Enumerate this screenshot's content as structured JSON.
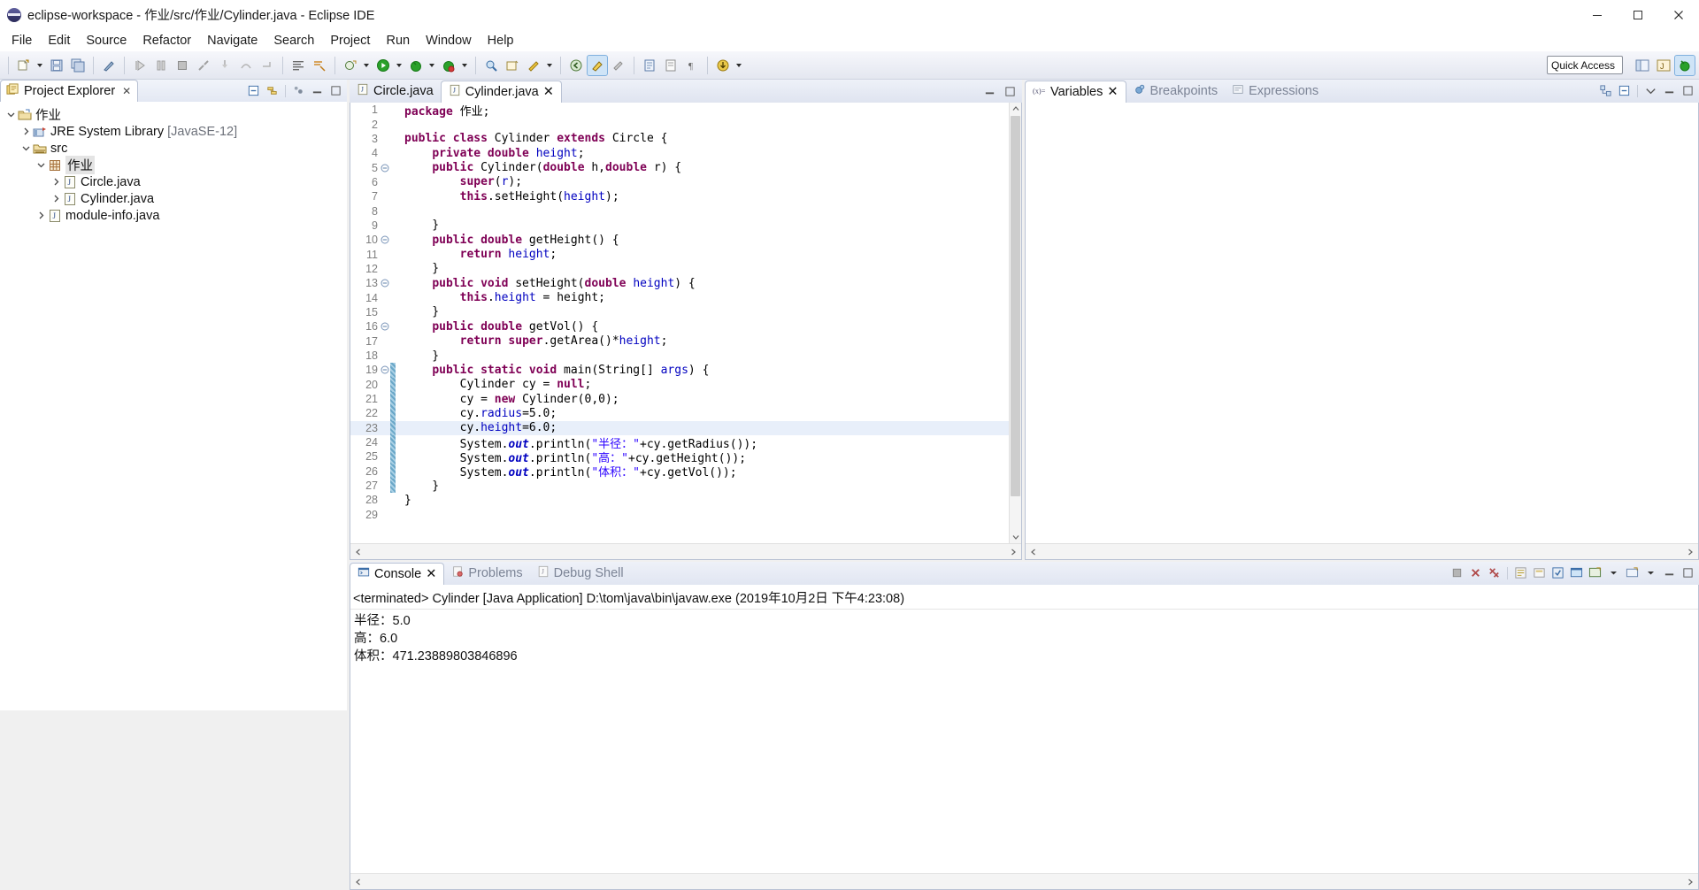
{
  "window": {
    "title": "eclipse-workspace - 作业/src/作业/Cylinder.java - Eclipse IDE",
    "minimize": "minimize-button",
    "maximize": "maximize-button",
    "close": "close-button"
  },
  "menubar": {
    "items": [
      "File",
      "Edit",
      "Source",
      "Refactor",
      "Navigate",
      "Search",
      "Project",
      "Run",
      "Window",
      "Help"
    ]
  },
  "toolbar": {
    "quick_access_placeholder": "Quick Access"
  },
  "explorer": {
    "tab_label": "Project Explorer",
    "tree": [
      {
        "label": "作业",
        "indent": 0,
        "twist": "down",
        "icon": "project-icon"
      },
      {
        "label": "JRE System Library",
        "suffix": " [JavaSE-12]",
        "indent": 1,
        "twist": "right",
        "icon": "library-icon"
      },
      {
        "label": "src",
        "indent": 1,
        "twist": "down",
        "icon": "source-folder-icon"
      },
      {
        "label": "作业",
        "indent": 2,
        "twist": "down",
        "icon": "package-icon",
        "highlight": true
      },
      {
        "label": "Circle.java",
        "indent": 3,
        "twist": "right",
        "icon": "java-file-icon"
      },
      {
        "label": "Cylinder.java",
        "indent": 3,
        "twist": "right",
        "icon": "java-file-icon"
      },
      {
        "label": "module-info.java",
        "indent": 2,
        "twist": "right",
        "icon": "java-file-icon"
      }
    ]
  },
  "editor": {
    "tabs": [
      {
        "label": "Circle.java",
        "active": false,
        "closable": false
      },
      {
        "label": "Cylinder.java",
        "active": true,
        "closable": true
      }
    ],
    "current_line": 23,
    "change_bar_lines": [
      19,
      20,
      21,
      22,
      23,
      24,
      25,
      26,
      27
    ],
    "lines": [
      {
        "n": 1,
        "fold": false,
        "tokens": [
          {
            "t": "package ",
            "c": "kw"
          },
          {
            "t": "作业",
            "c": ""
          },
          {
            "t": ";",
            "c": ""
          }
        ]
      },
      {
        "n": 2,
        "fold": false,
        "tokens": []
      },
      {
        "n": 3,
        "fold": false,
        "tokens": [
          {
            "t": "public class ",
            "c": "kw"
          },
          {
            "t": "Cylinder ",
            "c": ""
          },
          {
            "t": "extends ",
            "c": "kw"
          },
          {
            "t": "Circle {",
            "c": ""
          }
        ]
      },
      {
        "n": 4,
        "fold": false,
        "tokens": [
          {
            "t": "    ",
            "c": ""
          },
          {
            "t": "private double ",
            "c": "kw"
          },
          {
            "t": "height",
            "c": "fld"
          },
          {
            "t": ";",
            "c": ""
          }
        ]
      },
      {
        "n": 5,
        "fold": true,
        "tokens": [
          {
            "t": "    ",
            "c": ""
          },
          {
            "t": "public ",
            "c": "kw"
          },
          {
            "t": "Cylinder(",
            "c": ""
          },
          {
            "t": "double ",
            "c": "kw"
          },
          {
            "t": "h,",
            "c": ""
          },
          {
            "t": "double ",
            "c": "kw"
          },
          {
            "t": "r) {",
            "c": ""
          }
        ]
      },
      {
        "n": 6,
        "fold": false,
        "tokens": [
          {
            "t": "        ",
            "c": ""
          },
          {
            "t": "super",
            "c": "kw"
          },
          {
            "t": "(",
            "c": ""
          },
          {
            "t": "r",
            "c": "fld"
          },
          {
            "t": ");",
            "c": ""
          }
        ]
      },
      {
        "n": 7,
        "fold": false,
        "tokens": [
          {
            "t": "        ",
            "c": ""
          },
          {
            "t": "this",
            "c": "kw"
          },
          {
            "t": ".setHeight(",
            "c": ""
          },
          {
            "t": "height",
            "c": "fld"
          },
          {
            "t": ");",
            "c": ""
          }
        ]
      },
      {
        "n": 8,
        "fold": false,
        "tokens": []
      },
      {
        "n": 9,
        "fold": false,
        "tokens": [
          {
            "t": "    }",
            "c": ""
          }
        ]
      },
      {
        "n": 10,
        "fold": true,
        "tokens": [
          {
            "t": "    ",
            "c": ""
          },
          {
            "t": "public double ",
            "c": "kw"
          },
          {
            "t": "getHeight() {",
            "c": ""
          }
        ]
      },
      {
        "n": 11,
        "fold": false,
        "tokens": [
          {
            "t": "        ",
            "c": ""
          },
          {
            "t": "return ",
            "c": "kw"
          },
          {
            "t": "height",
            "c": "fld"
          },
          {
            "t": ";",
            "c": ""
          }
        ]
      },
      {
        "n": 12,
        "fold": false,
        "tokens": [
          {
            "t": "    }",
            "c": ""
          }
        ]
      },
      {
        "n": 13,
        "fold": true,
        "tokens": [
          {
            "t": "    ",
            "c": ""
          },
          {
            "t": "public void ",
            "c": "kw"
          },
          {
            "t": "setHeight(",
            "c": ""
          },
          {
            "t": "double ",
            "c": "kw"
          },
          {
            "t": "height",
            "c": "fld"
          },
          {
            "t": ") {",
            "c": ""
          }
        ]
      },
      {
        "n": 14,
        "fold": false,
        "tokens": [
          {
            "t": "        ",
            "c": ""
          },
          {
            "t": "this",
            "c": "kw"
          },
          {
            "t": ".",
            "c": ""
          },
          {
            "t": "height",
            "c": "fld"
          },
          {
            "t": " = height;",
            "c": ""
          }
        ]
      },
      {
        "n": 15,
        "fold": false,
        "tokens": [
          {
            "t": "    }",
            "c": ""
          }
        ]
      },
      {
        "n": 16,
        "fold": true,
        "tokens": [
          {
            "t": "    ",
            "c": ""
          },
          {
            "t": "public double ",
            "c": "kw"
          },
          {
            "t": "getVol() {",
            "c": ""
          }
        ]
      },
      {
        "n": 17,
        "fold": false,
        "tokens": [
          {
            "t": "        ",
            "c": ""
          },
          {
            "t": "return ",
            "c": "kw"
          },
          {
            "t": "super",
            "c": "kw"
          },
          {
            "t": ".getArea()*",
            "c": ""
          },
          {
            "t": "height",
            "c": "fld"
          },
          {
            "t": ";",
            "c": ""
          }
        ]
      },
      {
        "n": 18,
        "fold": false,
        "tokens": [
          {
            "t": "    }",
            "c": ""
          }
        ]
      },
      {
        "n": 19,
        "fold": true,
        "tokens": [
          {
            "t": "    ",
            "c": ""
          },
          {
            "t": "public static void ",
            "c": "kw"
          },
          {
            "t": "main(String[] ",
            "c": ""
          },
          {
            "t": "args",
            "c": "fld"
          },
          {
            "t": ") {",
            "c": ""
          }
        ]
      },
      {
        "n": 20,
        "fold": false,
        "tokens": [
          {
            "t": "        Cylinder cy = ",
            "c": ""
          },
          {
            "t": "null",
            "c": "kw"
          },
          {
            "t": ";",
            "c": ""
          }
        ]
      },
      {
        "n": 21,
        "fold": false,
        "tokens": [
          {
            "t": "        cy = ",
            "c": ""
          },
          {
            "t": "new ",
            "c": "kw"
          },
          {
            "t": "Cylinder(0,0);",
            "c": ""
          }
        ]
      },
      {
        "n": 22,
        "fold": false,
        "tokens": [
          {
            "t": "        cy.",
            "c": ""
          },
          {
            "t": "radius",
            "c": "fld"
          },
          {
            "t": "=5.0;",
            "c": ""
          }
        ]
      },
      {
        "n": 23,
        "fold": false,
        "tokens": [
          {
            "t": "        cy.",
            "c": ""
          },
          {
            "t": "height",
            "c": "fld"
          },
          {
            "t": "=6.0;",
            "c": ""
          }
        ]
      },
      {
        "n": 24,
        "fold": false,
        "tokens": [
          {
            "t": "        System.",
            "c": ""
          },
          {
            "t": "out",
            "c": "stat"
          },
          {
            "t": ".println(",
            "c": ""
          },
          {
            "t": "\"半径：\"",
            "c": "str"
          },
          {
            "t": "+cy.getRadius());",
            "c": ""
          }
        ]
      },
      {
        "n": 25,
        "fold": false,
        "tokens": [
          {
            "t": "        System.",
            "c": ""
          },
          {
            "t": "out",
            "c": "stat"
          },
          {
            "t": ".println(",
            "c": ""
          },
          {
            "t": "\"高：\"",
            "c": "str"
          },
          {
            "t": "+cy.getHeight());",
            "c": ""
          }
        ]
      },
      {
        "n": 26,
        "fold": false,
        "tokens": [
          {
            "t": "        System.",
            "c": ""
          },
          {
            "t": "out",
            "c": "stat"
          },
          {
            "t": ".println(",
            "c": ""
          },
          {
            "t": "\"体积：\"",
            "c": "str"
          },
          {
            "t": "+cy.getVol());",
            "c": ""
          }
        ]
      },
      {
        "n": 27,
        "fold": false,
        "tokens": [
          {
            "t": "    }",
            "c": ""
          }
        ]
      },
      {
        "n": 28,
        "fold": false,
        "tokens": [
          {
            "t": "}",
            "c": ""
          }
        ]
      },
      {
        "n": 29,
        "fold": false,
        "tokens": []
      }
    ]
  },
  "variables": {
    "tabs": [
      {
        "label": "Variables",
        "active": true,
        "icon": "variables-icon"
      },
      {
        "label": "Breakpoints",
        "active": false,
        "icon": "breakpoints-icon"
      },
      {
        "label": "Expressions",
        "active": false,
        "icon": "expressions-icon"
      }
    ]
  },
  "console": {
    "tabs": [
      {
        "label": "Console",
        "active": true,
        "icon": "console-icon"
      },
      {
        "label": "Problems",
        "active": false,
        "icon": "problems-icon"
      },
      {
        "label": "Debug Shell",
        "active": false,
        "icon": "debug-shell-icon"
      }
    ],
    "header": "<terminated> Cylinder [Java Application] D:\\tom\\java\\bin\\javaw.exe (2019年10月2日 下午4:23:08)",
    "output": [
      "半径：5.0",
      "高：6.0",
      "体积：471.23889803846896"
    ]
  },
  "colors": {
    "keyword": "#7f0055",
    "string": "#2a00ff",
    "field": "#0000c0",
    "current_line": "#e8effa",
    "change_bar": "#6aa7c8",
    "accent": "#3d6ea8"
  }
}
